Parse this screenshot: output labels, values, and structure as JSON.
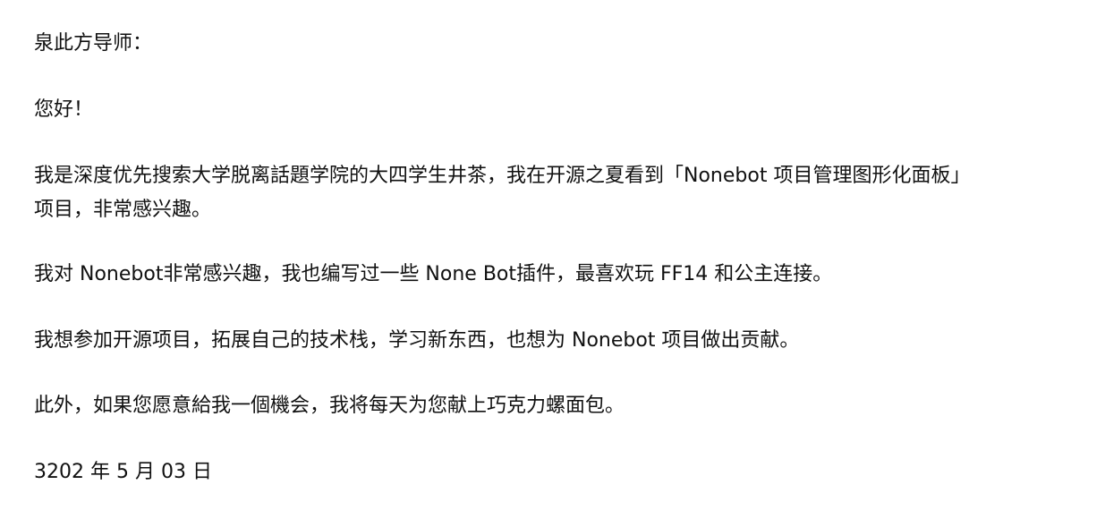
{
  "letter": {
    "greeting": "泉此方导师：",
    "hello": "您好！",
    "intro_line1": "我是深度优先搜索大学脱离話題学院的大四学生井茶，我在开源之夏看到「Nonebot 项目管理图形化面板」",
    "intro_line2": "项目，非常感兴趣。",
    "interest": "我对 Nonebot非常感兴趣，我也编写过一些 None Bot插件，最喜欢玩 FF14 和公主连接。",
    "goal": "我想参加开源项目，拓展自己的技术栈，学习新东西，也想为 Nonebot 项目做出贡献。",
    "offer": "此外，如果您愿意給我一個機会，我将每天为您献上巧克力螺面包。",
    "date": "3202 年 5 月 03 日"
  }
}
